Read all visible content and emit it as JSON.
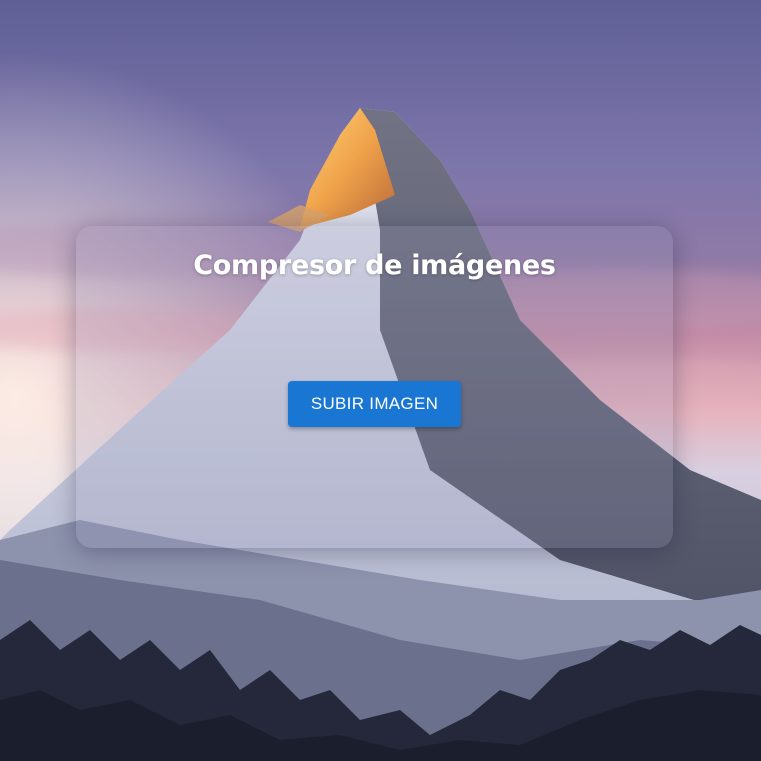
{
  "app": {
    "title": "Compresor de imágenes"
  },
  "upload": {
    "button_label": "SUBIR IMAGEN"
  },
  "colors": {
    "button_bg": "#1976d2",
    "button_text": "#ffffff",
    "title_text": "#ffffff"
  },
  "background": {
    "subject": "mountain-peak-at-sunset"
  }
}
